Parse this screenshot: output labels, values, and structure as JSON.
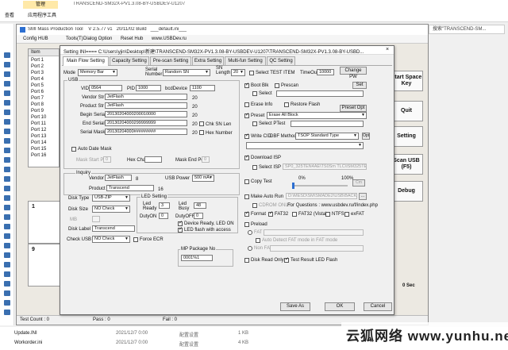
{
  "explorer": {
    "tab_manage": "管理",
    "tab_view": "查看",
    "tab_apptools": "应用程序工具",
    "window_title": "TRANSCEND-SM32X-PV1.3.08-BY-USBDEV-U1207",
    "search_placeholder": "搜索\"TRANSCEND-SM...",
    "files": [
      {
        "name": "Update.INI",
        "date": "2021/12/7 0:00",
        "type": "配置设置",
        "size": "1 KB"
      },
      {
        "name": "Workorder.ini",
        "date": "2021/12/7 0:00",
        "type": "配置设置",
        "size": "4 KB"
      }
    ]
  },
  "main": {
    "title": "SMI Mass Production Tool",
    "version": "V 2.5.77 v1",
    "date": "20/11/02 Build",
    "ini": "___default.ini___",
    "menu": [
      "Config HUB",
      "Tools(T)",
      "Dialog Option",
      "Reset Hub",
      "www.USBDev.ru"
    ],
    "port_header": "Item",
    "ports": [
      "Port 1",
      "Port 2",
      "Port 3",
      "Port 4",
      "Port 5",
      "Port 6",
      "Port 7",
      "Port 8",
      "Port 9",
      "Port 10",
      "Port 11",
      "Port 12",
      "Port 13",
      "Port 14",
      "Port 15",
      "Port 16"
    ],
    "port_box_1": "1",
    "port_box_9": "9",
    "side_buttons": [
      "Start Space Key",
      "Quit",
      "Setting",
      "Scan USB (F5)",
      "Debug"
    ],
    "rpm_label": "0 Sec",
    "status": {
      "test_count": "Test Count : 0",
      "pass": "Pass : 0",
      "fail": "Fail : 0"
    }
  },
  "dialog": {
    "title": "Setting  INI==== C:\\Users\\yjin\\Desktop\\新建\\TRANSCEND-SM32X-PV1.3.08-BY-USBDEV-U1207\\TRANSCEND-SM32X-PV1.3.08-BY-USBD...",
    "close": "×",
    "tabs": [
      "Main Flow Setting",
      "Capacity Setting",
      "Pre-scan Setting",
      "Extra Setting",
      "Multi-fun Setting",
      "QC Setting"
    ],
    "mode_label": "Mode",
    "mode_value": "Memory Bar",
    "serial_number_label": "Serial Number",
    "serial_number_value": "Random SN",
    "sn_length_label": "SN Length",
    "sn_length_value": "20",
    "select_test_item": "Select TEST ITEM",
    "timeout_label": "TimeOut",
    "timeout_value": "10000",
    "change_pw": "Change PW",
    "usb_group": "USB",
    "vid_label": "VID",
    "vid_value": "0564",
    "pid_label": "PID",
    "pid_value": "1000",
    "bcd_label": "bcdDevice",
    "bcd_value": "1100",
    "vendor_str_label": "Vendor Str",
    "vendor_str_value": "JetFlash",
    "vendor_str_len": "20",
    "product_str_label": "Product Str",
    "product_str_value": "JetFlash",
    "product_str_len": "20",
    "begin_serial_label": "Begin Serial",
    "begin_serial_value": "20130204000200010000",
    "begin_serial_len": "20",
    "end_serial_label": "End Serial",
    "end_serial_value": "20130204000299999999",
    "end_serial_len": "20",
    "serial_mask_label": "Serial Mask",
    "serial_mask_value": "20130204000#########",
    "serial_mask_len": "20",
    "chk_sn_len": "Chk SN Len",
    "hex_number": "Hex Number",
    "auto_date_mask": "Auto Date Mask",
    "mask_start_pos": "Mask Start Pos",
    "mask_start_val": "0",
    "hex_char": "Hex Char",
    "mask_end_pos": "Mask End Pos",
    "mask_end_val": "0",
    "inquiry_group": "Inquiry",
    "inq_vendor_label": "Vendor",
    "inq_vendor_value": "JetFlash",
    "inq_vendor_len": "8",
    "inq_product_label": "Product",
    "inq_product_value": "Transcend",
    "inq_product_len": "16",
    "usb_power_label": "USB Power",
    "usb_power_value": "500 mA",
    "disk_type_label": "Disk Type",
    "disk_type_value": "USB-ZIP",
    "disk_size_label": "Disk Size",
    "disk_size_value": "NO Check",
    "disk_size_unit": "MB",
    "disk_label_label": "Disk Label",
    "disk_label_value": "Transcend",
    "check_usb_label": "Check USB",
    "check_usb_value": "NO Check",
    "force_ecr": "Force ECR",
    "led_group": "LED Setting",
    "led_ready_label": "Led Ready",
    "led_ready_value": "3",
    "led_busy_label": "Led Busy",
    "led_busy_value": "48",
    "duty_on_label": "DutyON",
    "duty_on_value": "0",
    "duty_off_label": "DutyOFF",
    "duty_off_value": "0",
    "device_ready_led": "Device Ready, LED ON",
    "led_flash_access": "LED flash with access",
    "mp_package_label": "MP Package No",
    "mp_package_value": "0001%1",
    "boot_blk": "Boot Blk",
    "prescan": "Prescan",
    "set": "Set",
    "select": "Select",
    "erase_info": "Erase Info",
    "restore_flash": "Restore Flash",
    "preset_opt": "Preset Opt",
    "preset": "Preset",
    "preset_value": "Erase All Block",
    "select_preset": "Select PTest",
    "write_cid": "Write CID",
    "dbf_method": "DBF Method",
    "dbf_value": "TSOP Standard Type",
    "opt": "Opt",
    "download_isp": "Download ISP",
    "select_isp": "Select ISP",
    "isp_value": "SP0_325TEN4AE\\TS0Sm TLC\\ISM325TEN",
    "copy_test": "Copy Test",
    "copy_pct_min": "0%",
    "copy_pct_max": "100%",
    "copy_suffix": "Cm",
    "make_auto_run": "Make Auto Run",
    "auto_run_value": "D:\\MESD\\SM\\SMADE2\\USB\\BACK\\P_MB Driver",
    "cdrom_only": "CDROM ONLY",
    "questions": "For Questions : www.usbdev.ru/f/index.php",
    "format": "Format",
    "fat32": "FAT32",
    "fat32_vista": "FAT32 (Vista)",
    "ntfs": "NTFS",
    "exfat": "exFAT",
    "preload": "Preload",
    "pre_fat": "FAT",
    "auto_dram": "Auto Detect FAT mode in FAT mode",
    "ntfs_fat": "Non FAT",
    "disk_read_only": "Disk Read Only",
    "test_result_led": "Test Result LED Flash",
    "save_as": "Save As",
    "ok": "OK",
    "cancel": "Cancel"
  },
  "watermark": "云狐网络 www.yunhu.net"
}
